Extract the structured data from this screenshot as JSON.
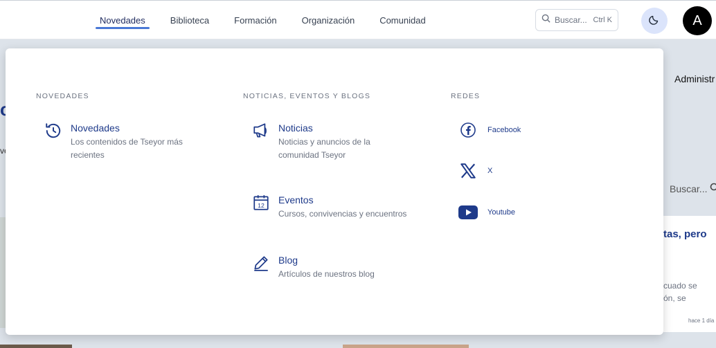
{
  "nav": {
    "items": [
      {
        "label": "Novedades",
        "active": true
      },
      {
        "label": "Biblioteca",
        "active": false
      },
      {
        "label": "Formación",
        "active": false
      },
      {
        "label": "Organización",
        "active": false
      },
      {
        "label": "Comunidad",
        "active": false
      }
    ],
    "search_placeholder": "Buscar...",
    "search_shortcut": "Ctrl K",
    "avatar_initial": "A"
  },
  "background": {
    "admin_text": "Administr",
    "search_text": "Buscar...",
    "card_title": "tas, pero",
    "card_text_1": "cuado se",
    "card_text_2": "ón, se",
    "card_time": "hace 1 día",
    "left_letter": "c",
    "left_letter_2": "ve"
  },
  "menu": {
    "col1": {
      "heading": "NOVEDADES",
      "entries": [
        {
          "title": "Novedades",
          "desc_line1": "Los contenidos de Tseyor más",
          "desc_line2": "recientes",
          "icon": "history-icon"
        }
      ]
    },
    "col2": {
      "heading": "NOTICIAS, EVENTOS Y BLOGS",
      "entries": [
        {
          "title": "Noticias",
          "desc_line1": "Noticias y anuncios de la",
          "desc_line2": "comunidad Tseyor",
          "icon": "megaphone-icon"
        },
        {
          "title": "Eventos",
          "desc_line1": "Cursos, convivencias y encuentros",
          "icon": "calendar-icon",
          "calendar_day": "12"
        },
        {
          "title": "Blog",
          "desc_line1": "Artículos de nuestros blog",
          "icon": "pencil-icon"
        }
      ]
    },
    "col3": {
      "heading": "REDES",
      "links": [
        {
          "label": "Facebook",
          "icon": "facebook-icon"
        },
        {
          "label": "X",
          "icon": "x-icon"
        },
        {
          "label": "Youtube",
          "icon": "youtube-icon"
        }
      ]
    }
  },
  "colors": {
    "accent": "#4a78d6",
    "link": "#1e3a8a",
    "icon": "#1e3a8a"
  }
}
